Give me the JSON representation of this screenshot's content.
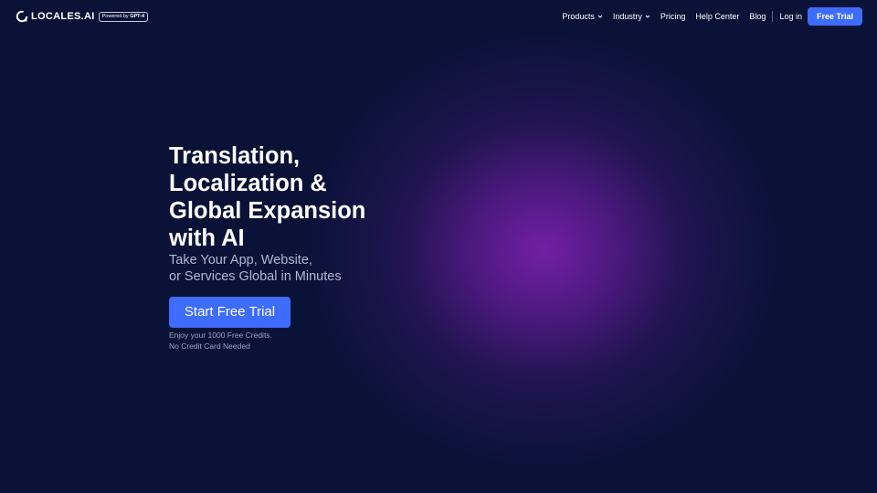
{
  "brand": {
    "name": "LOCALES.AI",
    "powered_prefix": "Powered by",
    "powered_model": "GPT-4"
  },
  "nav": {
    "items": [
      {
        "label": "Products",
        "dropdown": true
      },
      {
        "label": "Industry",
        "dropdown": true
      },
      {
        "label": "Pricing"
      },
      {
        "label": "Help Center"
      },
      {
        "label": "Blog"
      }
    ],
    "login": "Log in",
    "cta": "Free Trial"
  },
  "hero": {
    "headline_lines": [
      "Translation,",
      "Localization &",
      "Global Expansion",
      "with AI"
    ],
    "subtitle_lines": [
      "Take Your App, Website,",
      "or Services Global in Minutes"
    ],
    "button": "Start Free Trial",
    "note_lines": [
      "Enjoy your 1000 Free Credits.",
      "No Credit Card Needed"
    ]
  },
  "colors": {
    "background": "#0a1238",
    "accent": "#3d6cff",
    "glow": "#7a1fae"
  }
}
